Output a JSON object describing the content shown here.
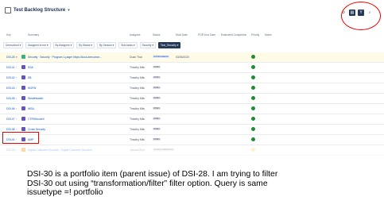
{
  "header": {
    "title": "Test Backlog Structure",
    "icons": [
      "gear-icon",
      "view-toggle-icon",
      "filter-icon",
      "search-icon"
    ]
  },
  "columns": {
    "key": "Key",
    "summary": "Summary",
    "assignee": "Assignee",
    "status": "Status",
    "start_date": "Start Date",
    "due_date": "POR Due Date",
    "estimated_completion": "Estimated Completion",
    "priority": "Priority",
    "notes": "Notes"
  },
  "toolbar": [
    {
      "label": "Unresolved ▾",
      "active": false
    },
    {
      "label": "Assigned to me ▾",
      "active": false
    },
    {
      "label": "By Assignee ▾",
      "active": false
    },
    {
      "label": "By Status ▾",
      "active": false
    },
    {
      "label": "By Version ▾",
      "active": false
    },
    {
      "label": "Sub-tasks ▾",
      "active": false
    },
    {
      "label": "Security ▾",
      "active": false
    },
    {
      "label": "Test_Security ▾",
      "active": true
    }
  ],
  "rows": [
    {
      "key": "DSI-28",
      "summary": "Security · Security · Program 1-pager https://docs.deecomm...",
      "assignee": "Doan Thai",
      "status": "IN PROGRESS",
      "start": "03/06/2020",
      "type": "parent"
    },
    {
      "key": "DSI-41",
      "summary": "SSA",
      "assignee": "Timothy Mitc",
      "status": "OPEN",
      "start": "",
      "type": "feature"
    },
    {
      "key": "DSI-42",
      "summary": "SB",
      "assignee": "Timothy Mitc",
      "status": "OPEN",
      "start": "",
      "type": "feature"
    },
    {
      "key": "DSI-43",
      "summary": "NGFW",
      "assignee": "Timothy Mitc",
      "status": "OPEN",
      "start": "",
      "type": "feature"
    },
    {
      "key": "DSI-45",
      "summary": "Stealthwatch",
      "assignee": "Timothy Mitc",
      "status": "OPEN",
      "start": "",
      "type": "feature"
    },
    {
      "key": "DSI-46",
      "summary": "WSA",
      "assignee": "Timothy Mitc",
      "status": "OPEN",
      "start": "",
      "type": "feature"
    },
    {
      "key": "DSI-47",
      "summary": "CTR/SecureX",
      "assignee": "Timothy Mitc",
      "status": "OPEN",
      "start": "",
      "type": "feature"
    },
    {
      "key": "DSI-38",
      "summary": "Cross Security",
      "assignee": "Timothy Mitc",
      "status": "OPEN",
      "start": "",
      "type": "feature"
    },
    {
      "key": "DSI-44",
      "summary": "AMP",
      "assignee": "Timothy Mitc",
      "status": "OPEN",
      "start": "",
      "type": "feature"
    },
    {
      "key": "DSI-30",
      "summary": "Digital Customer Success · Digital Customer Success",
      "assignee": "Jessica Bhor",
      "status": "IN REQUIREMENTS",
      "start": "",
      "type": "portfolio"
    }
  ],
  "caption": [
    "DSI-30 is a portfolio item (parent issue) of DSI-28. I am trying to filter",
    "DSI-30 out using “transformation/filter” filter option. Query is same",
    "issuetype =! portfolio"
  ],
  "annotation_color": "#ee0000"
}
